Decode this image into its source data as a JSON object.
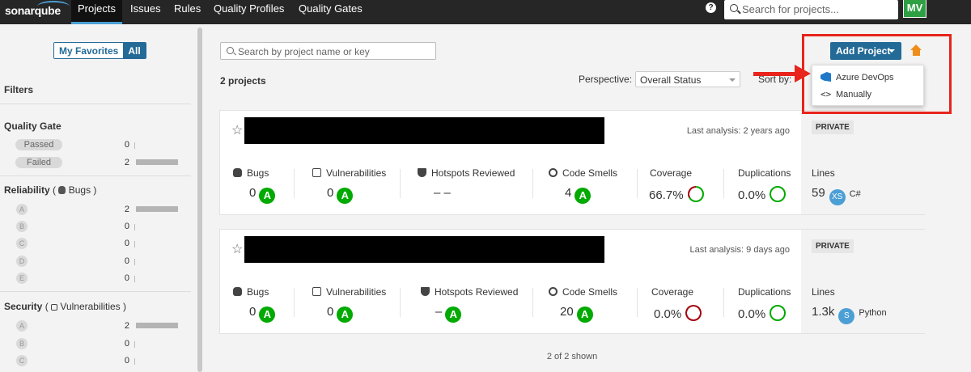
{
  "topnav": {
    "logo": "sonarqube",
    "items": [
      "Projects",
      "Issues",
      "Rules",
      "Quality Profiles",
      "Quality Gates"
    ],
    "help": "?",
    "search_placeholder": "Search for projects...",
    "avatar": "MV"
  },
  "sidebar": {
    "toggle": [
      "My Favorites",
      "All"
    ],
    "filters_title": "Filters",
    "quality_gate": {
      "title": "Quality Gate",
      "rows": [
        {
          "label": "Passed",
          "count": "0",
          "fraction": 0
        },
        {
          "label": "Failed",
          "count": "2",
          "fraction": 1
        }
      ]
    },
    "reliability": {
      "title": "Reliability",
      "sub": "Bugs",
      "rows": [
        {
          "label": "A",
          "count": "2",
          "fraction": 1
        },
        {
          "label": "B",
          "count": "0",
          "fraction": 0
        },
        {
          "label": "C",
          "count": "0",
          "fraction": 0
        },
        {
          "label": "D",
          "count": "0",
          "fraction": 0
        },
        {
          "label": "E",
          "count": "0",
          "fraction": 0
        }
      ]
    },
    "security": {
      "title": "Security",
      "sub": "Vulnerabilities",
      "rows": [
        {
          "label": "A",
          "count": "2",
          "fraction": 1
        },
        {
          "label": "B",
          "count": "0",
          "fraction": 0
        },
        {
          "label": "C",
          "count": "0",
          "fraction": 0
        }
      ]
    }
  },
  "main": {
    "search_placeholder": "Search by project name or key",
    "count_label": "2 projects",
    "perspective_label": "Perspective:",
    "perspective_value": "Overall Status",
    "sort_label": "Sort by:",
    "add_project": "Add Project",
    "dropdown": [
      "Azure DevOps",
      "Manually"
    ],
    "shown": "2 of 2 shown",
    "projects": [
      {
        "last_analysis": "Last analysis: 2 years ago",
        "visibility": "PRIVATE",
        "bugs_label": "Bugs",
        "bugs": "0",
        "bugs_grade": "A",
        "vuln_label": "Vulnerabilities",
        "vuln": "0",
        "vuln_grade": "A",
        "hotspots_label": "Hotspots Reviewed",
        "hotspots": "– –",
        "smells_label": "Code Smells",
        "smells": "4",
        "smells_grade": "A",
        "coverage_label": "Coverage",
        "coverage": "66.7%",
        "coverage_fraction": 0.667,
        "dup_label": "Duplications",
        "dup": "0.0%",
        "lines_label": "Lines",
        "lines": "59",
        "size": "XS",
        "language": "C#"
      },
      {
        "last_analysis": "Last analysis: 9 days ago",
        "visibility": "PRIVATE",
        "bugs_label": "Bugs",
        "bugs": "0",
        "bugs_grade": "A",
        "vuln_label": "Vulnerabilities",
        "vuln": "0",
        "vuln_grade": "A",
        "hotspots_label": "Hotspots Reviewed",
        "hotspots": "–",
        "hotspots_grade": "A",
        "smells_label": "Code Smells",
        "smells": "20",
        "smells_grade": "A",
        "coverage_label": "Coverage",
        "coverage": "0.0%",
        "coverage_fraction": 0,
        "dup_label": "Duplications",
        "dup": "0.0%",
        "lines_label": "Lines",
        "lines": "1.3k",
        "size": "S",
        "language": "Python"
      }
    ]
  },
  "colors": {
    "accent": "#236a97",
    "grade_a": "#00aa00",
    "coverage_good": "#00aa00",
    "coverage_bad": "#a4030f",
    "annotation": "#e8241c"
  }
}
